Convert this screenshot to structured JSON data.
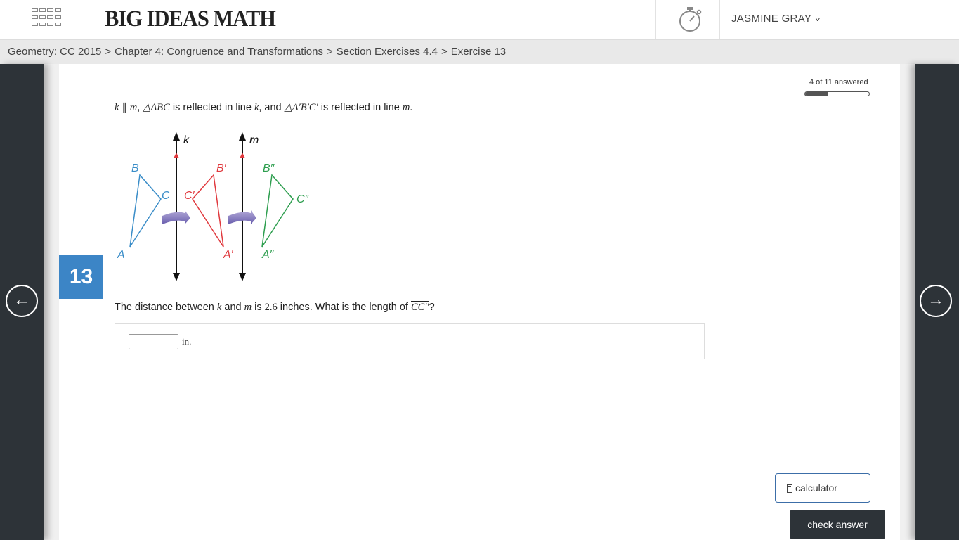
{
  "header": {
    "logo": "BIG IDEAS MATH",
    "user_name": "JASMINE GRAY",
    "user_chevron": "˅"
  },
  "breadcrumb": {
    "items": [
      "Geometry: CC 2015",
      "Chapter 4: Congruence and Transformations",
      "Section Exercises 4.4",
      "Exercise 13"
    ],
    "separator": ">"
  },
  "exercise": {
    "number": "13",
    "progress_label": "4 of 11 answered",
    "progress_fraction": 0.36,
    "problem": {
      "k": "k",
      "parallel": "∥",
      "m": "m",
      "comma": ",",
      "tri1": "△ABC",
      "text1": "is reflected in line",
      "k2": "k",
      "text2": ", and",
      "tri2": "△A′B′C′",
      "text3": "is reflected in line",
      "m2": "m",
      "end": "."
    },
    "question": {
      "text1": "The distance between",
      "k": "k",
      "and": "and",
      "m": "m",
      "is": "is",
      "value": "2.6",
      "text2": "inches. What is the length of",
      "segment": "CC′′",
      "end": "?"
    },
    "figure_labels": {
      "k": "k",
      "m": "m",
      "B": "B",
      "C": "C",
      "A": "A",
      "B1": "B′",
      "C1": "C′",
      "A1": "A′",
      "B2": "B″",
      "C2": "C″",
      "A2": "A″"
    },
    "answer": {
      "value": "",
      "unit": "in."
    }
  },
  "buttons": {
    "calculator": "calculator",
    "check": "check answer"
  },
  "nav": {
    "prev": "←",
    "next": "→"
  },
  "colors": {
    "blue": "#3a8dc8",
    "red": "#e0393e",
    "green": "#2e9e4f",
    "badge": "#3c85c6",
    "dark": "#2d3338"
  }
}
